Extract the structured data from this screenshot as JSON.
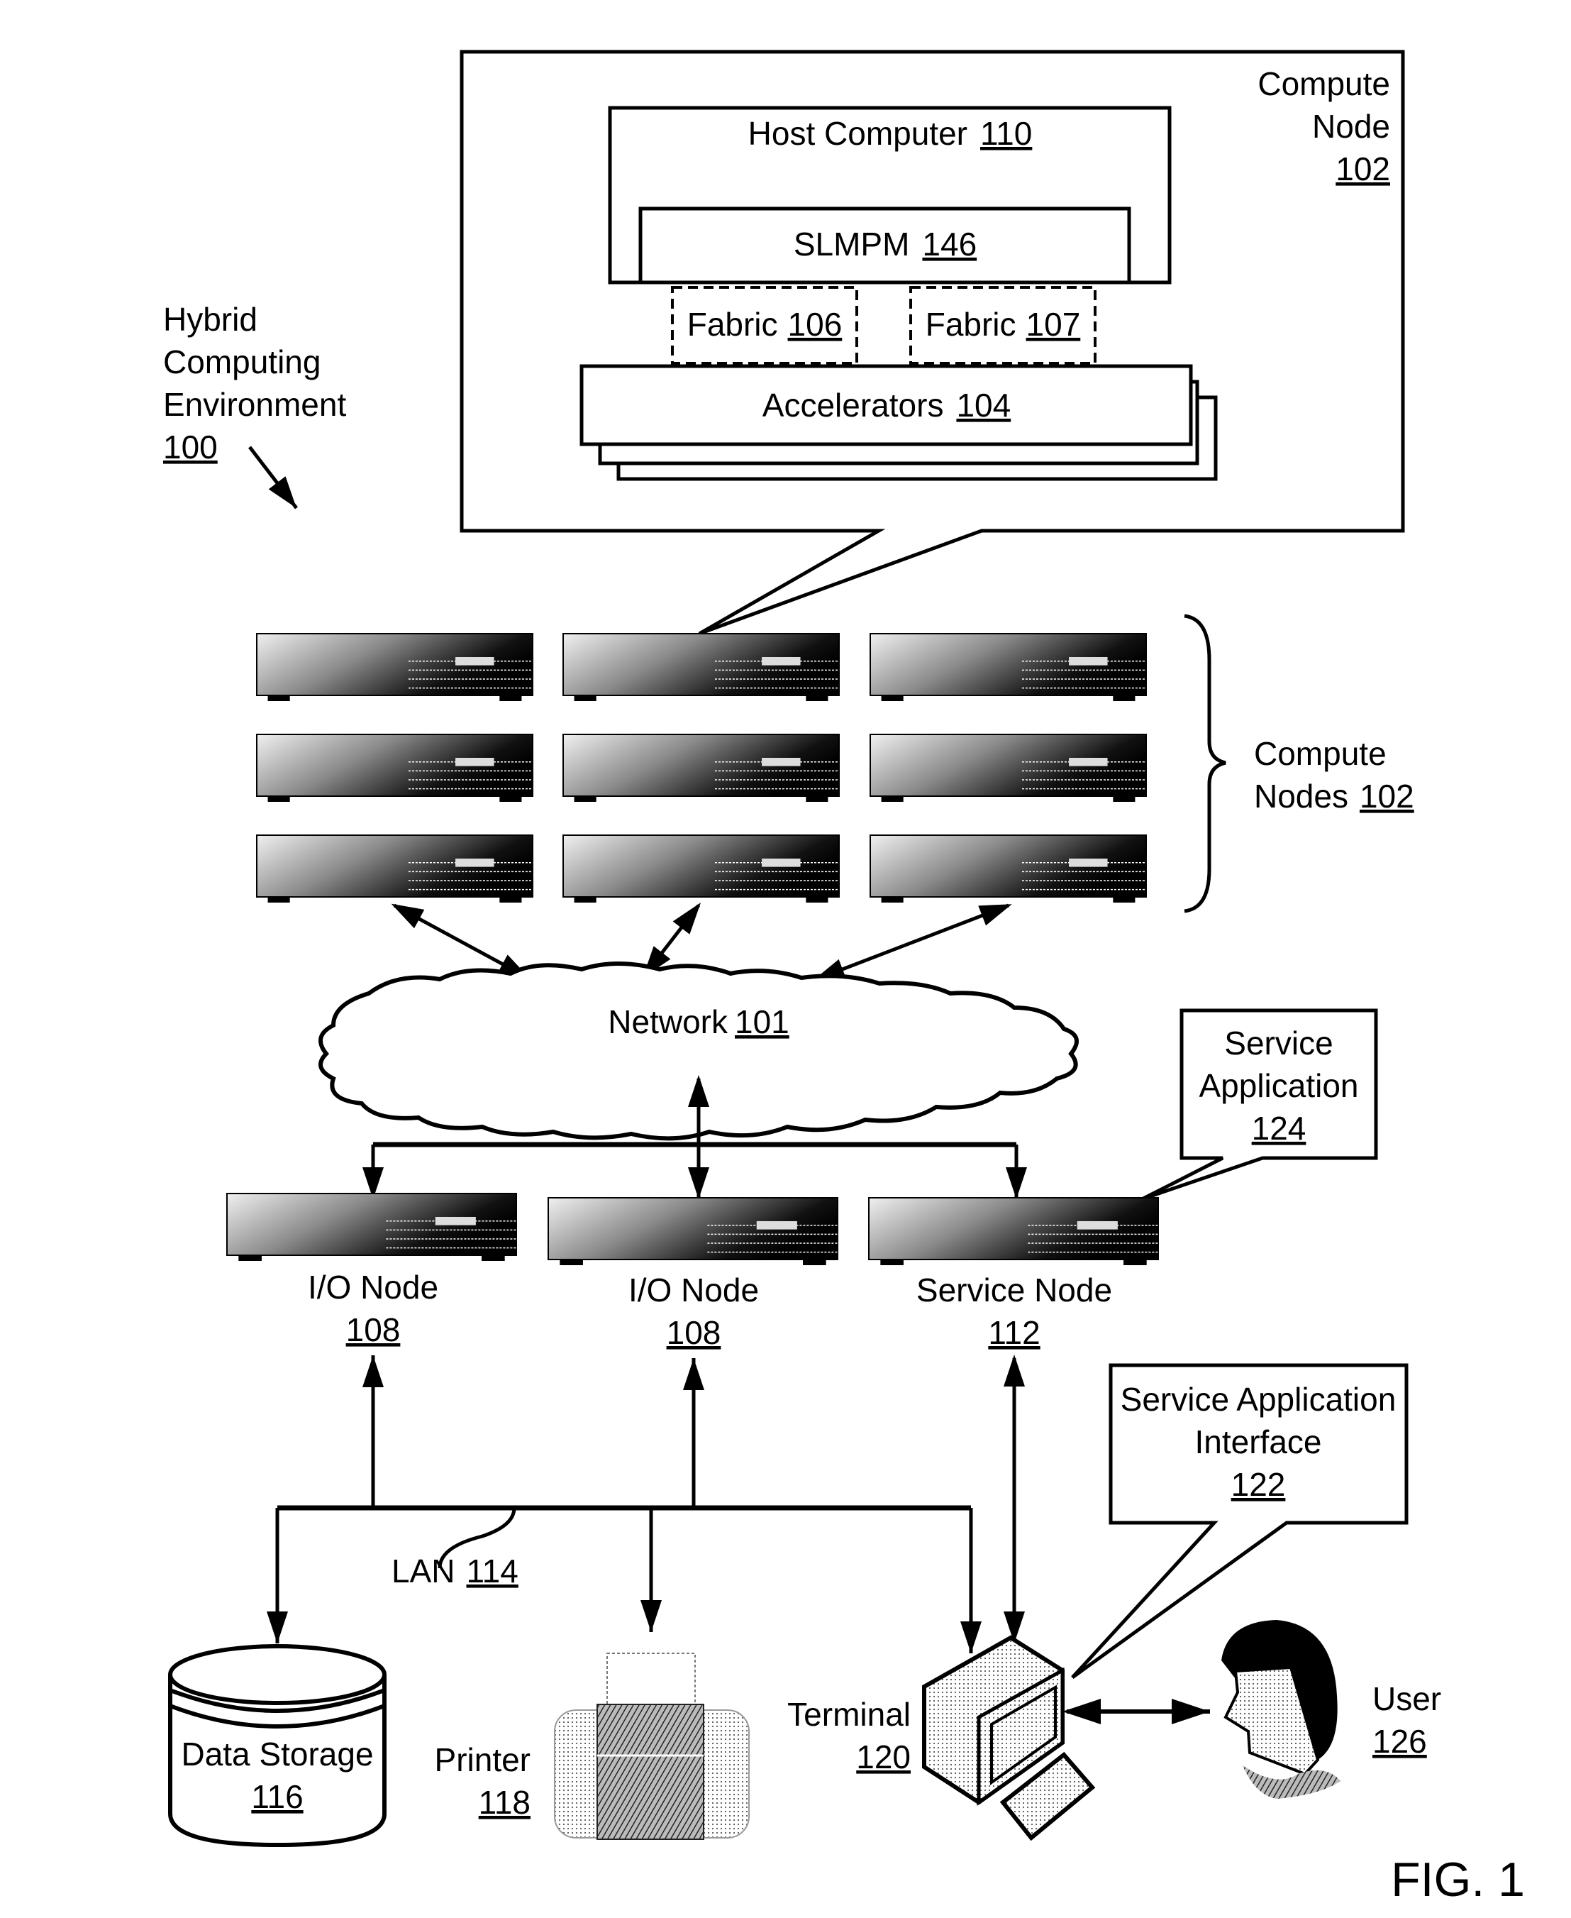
{
  "figure": {
    "label": "FIG. 1"
  },
  "environment": {
    "lines": [
      "Hybrid",
      "Computing",
      "Environment"
    ],
    "ref": "100"
  },
  "compute_node_detail": {
    "title_lines": [
      "Compute",
      "Node"
    ],
    "ref": "102",
    "host_computer": {
      "label": "Host Computer",
      "ref": "110"
    },
    "slmpm": {
      "label": "SLMPM",
      "ref": "146"
    },
    "fabrics": [
      {
        "label": "Fabric",
        "ref": "106"
      },
      {
        "label": "Fabric",
        "ref": "107"
      }
    ],
    "accelerators": {
      "label": "Accelerators",
      "ref": "104"
    }
  },
  "compute_nodes": {
    "lines": [
      "Compute",
      "Nodes"
    ],
    "ref": "102",
    "count": 9
  },
  "network": {
    "label": "Network",
    "ref": "101"
  },
  "service_application": {
    "lines": [
      "Service",
      "Application"
    ],
    "ref": "124"
  },
  "nodes": [
    {
      "label": "I/O Node",
      "ref": "108"
    },
    {
      "label": "I/O Node",
      "ref": "108"
    },
    {
      "label": "Service Node",
      "ref": "112"
    }
  ],
  "service_application_interface": {
    "lines": [
      "Service Application",
      "Interface"
    ],
    "ref": "122"
  },
  "lan": {
    "label": "LAN",
    "ref": "114"
  },
  "data_storage": {
    "label": "Data Storage",
    "ref": "116"
  },
  "printer": {
    "label": "Printer",
    "ref": "118"
  },
  "terminal": {
    "label": "Terminal",
    "ref": "120"
  },
  "user": {
    "label": "User",
    "ref": "126"
  }
}
